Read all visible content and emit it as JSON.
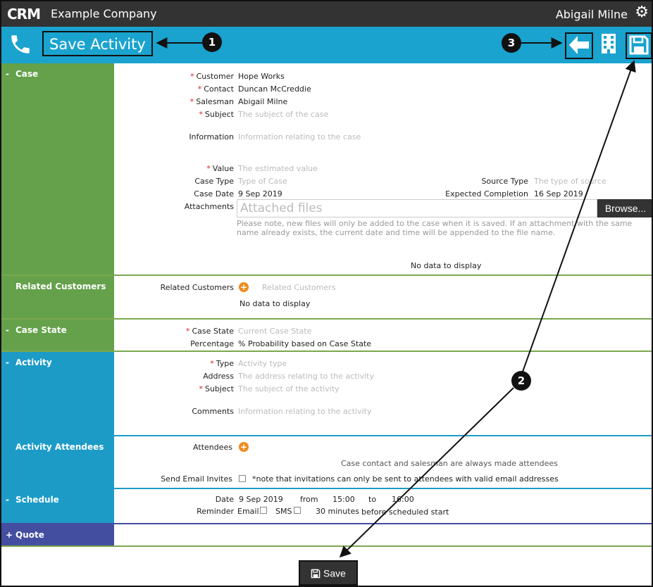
{
  "topbar": {
    "logo": "CRM",
    "company": "Example Company",
    "user": "Abigail Milne"
  },
  "actionbar": {
    "title": "Save Activity"
  },
  "callouts": [
    "1",
    "2",
    "3"
  ],
  "sections": {
    "case": {
      "label": "Case",
      "toggle": "-",
      "customer_label": "Customer",
      "customer_value": "Hope Works",
      "contact_label": "Contact",
      "contact_value": "Duncan McCreddie",
      "salesman_label": "Salesman",
      "salesman_value": "Abigail Milne",
      "subject_label": "Subject",
      "subject_placeholder": "The subject of the case",
      "information_label": "Information",
      "information_placeholder": "Information relating to the case",
      "value_label": "Value",
      "value_placeholder": "The estimated value",
      "case_type_label": "Case Type",
      "case_type_placeholder": "Type of Case",
      "source_type_label": "Source Type",
      "source_type_placeholder": "The type of source",
      "case_date_label": "Case Date",
      "case_date_value": "9 Sep 2019",
      "expected_completion_label": "Expected Completion",
      "expected_completion_value": "16 Sep 2019",
      "attachments_label": "Attachments",
      "attachments_placeholder": "Attached files",
      "browse_label": "Browse...",
      "note": "Please note, new files will only be added to the case when it is saved. If an attachment with the same name already exists, the current date and time will be appended to the file name.",
      "no_data": "No data to display"
    },
    "related_customers": {
      "label": "Related Customers",
      "field_label": "Related Customers",
      "placeholder": "Related Customers",
      "no_data": "No data to display"
    },
    "case_state": {
      "label": "Case State",
      "toggle": "-",
      "state_label": "Case State",
      "state_placeholder": "Current Case State",
      "percentage_label": "Percentage",
      "percentage_value": "% Probability based on Case State"
    },
    "activity": {
      "label": "Activity",
      "toggle": "-",
      "type_label": "Type",
      "type_placeholder": "Activity type",
      "address_label": "Address",
      "address_placeholder": "The address relating to the activity",
      "subject_label": "Subject",
      "subject_placeholder": "The subject of the activity",
      "comments_label": "Comments",
      "comments_placeholder": "Information relating to the activity"
    },
    "attendees": {
      "label": "Activity Attendees",
      "attendees_label": "Attendees",
      "info": "Case contact and salesman are always made attendees",
      "invites_label": "Send Email Invites",
      "invites_note": "*note that invitations can only be sent to attendees with valid email addresses"
    },
    "schedule": {
      "label": "Schedule",
      "toggle": "-",
      "date_label": "Date",
      "date_value": "9 Sep 2019",
      "from_label": "from",
      "from_value": "15:00",
      "to_label": "to",
      "to_value": "16:00",
      "reminder_label": "Reminder",
      "email_label": "Email",
      "sms_label": "SMS",
      "minutes_value": "30 minutes",
      "before_label": "before scheduled start"
    },
    "quote": {
      "label": "Quote",
      "toggle": "+"
    }
  },
  "footer": {
    "save_label": "Save"
  },
  "colors": {
    "green": "#64a14a",
    "blue": "#1c9bc7",
    "purple": "#434ea0",
    "topbar": "#333333",
    "actionbar": "#1aa3cf",
    "required": "#dd2222"
  }
}
